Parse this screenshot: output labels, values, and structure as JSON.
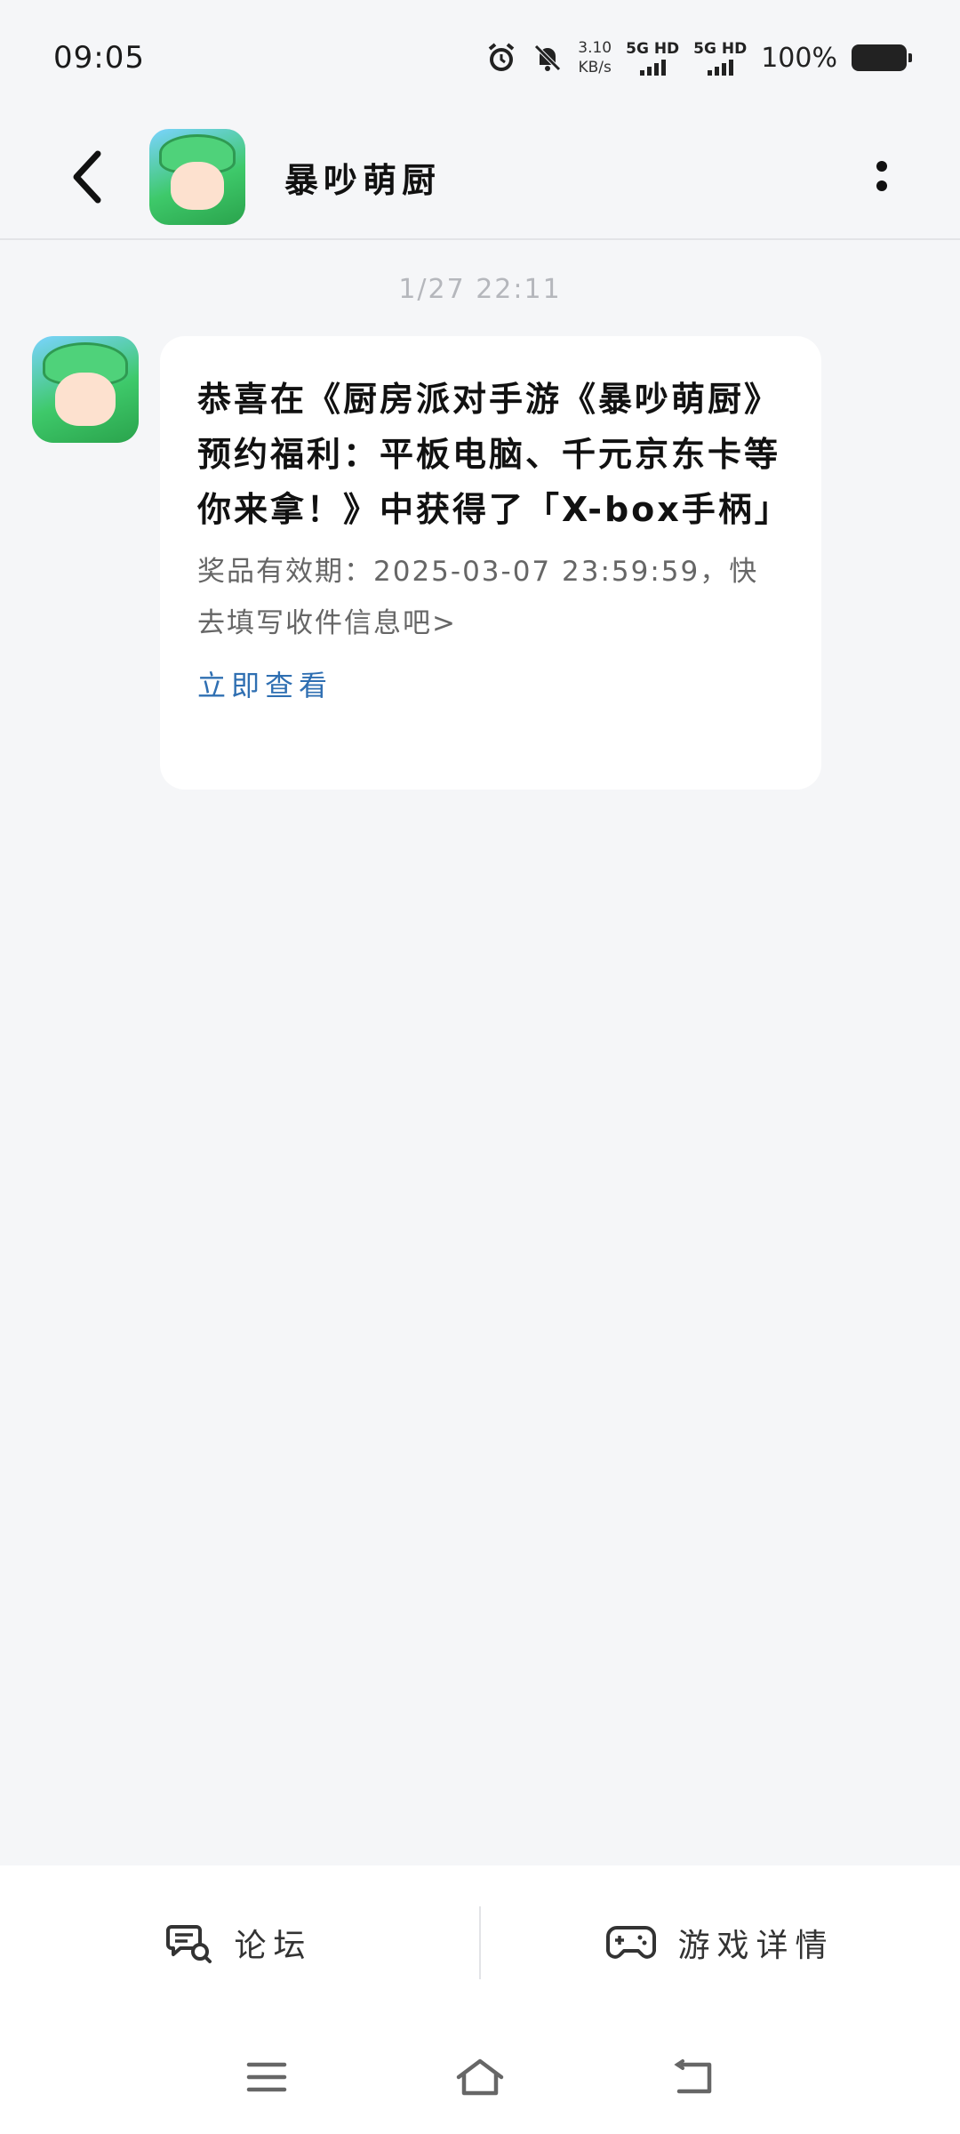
{
  "status_bar": {
    "time": "09:05",
    "net_speed_value": "3.10",
    "net_speed_unit": "KB/s",
    "sim1_label": "5G HD",
    "sim2_label": "5G HD",
    "battery_text": "100%"
  },
  "header": {
    "title": "暴吵萌厨"
  },
  "chat": {
    "timestamp": "1/27  22:11",
    "message": {
      "title": "恭喜在《厨房派对手游《暴吵萌厨》预约福利：平板电脑、千元京东卡等你来拿！》中获得了「X-box手柄」",
      "description": "奖品有效期：2025-03-07 23:59:59，快去填写收件信息吧>",
      "link_label": "立即查看"
    }
  },
  "bottom_bar": {
    "forum_label": "论坛",
    "game_detail_label": "游戏详情"
  },
  "colors": {
    "background": "#f5f6f8",
    "bubble": "#ffffff",
    "link": "#2f6fb2",
    "timestamp": "#b5b7bc"
  }
}
